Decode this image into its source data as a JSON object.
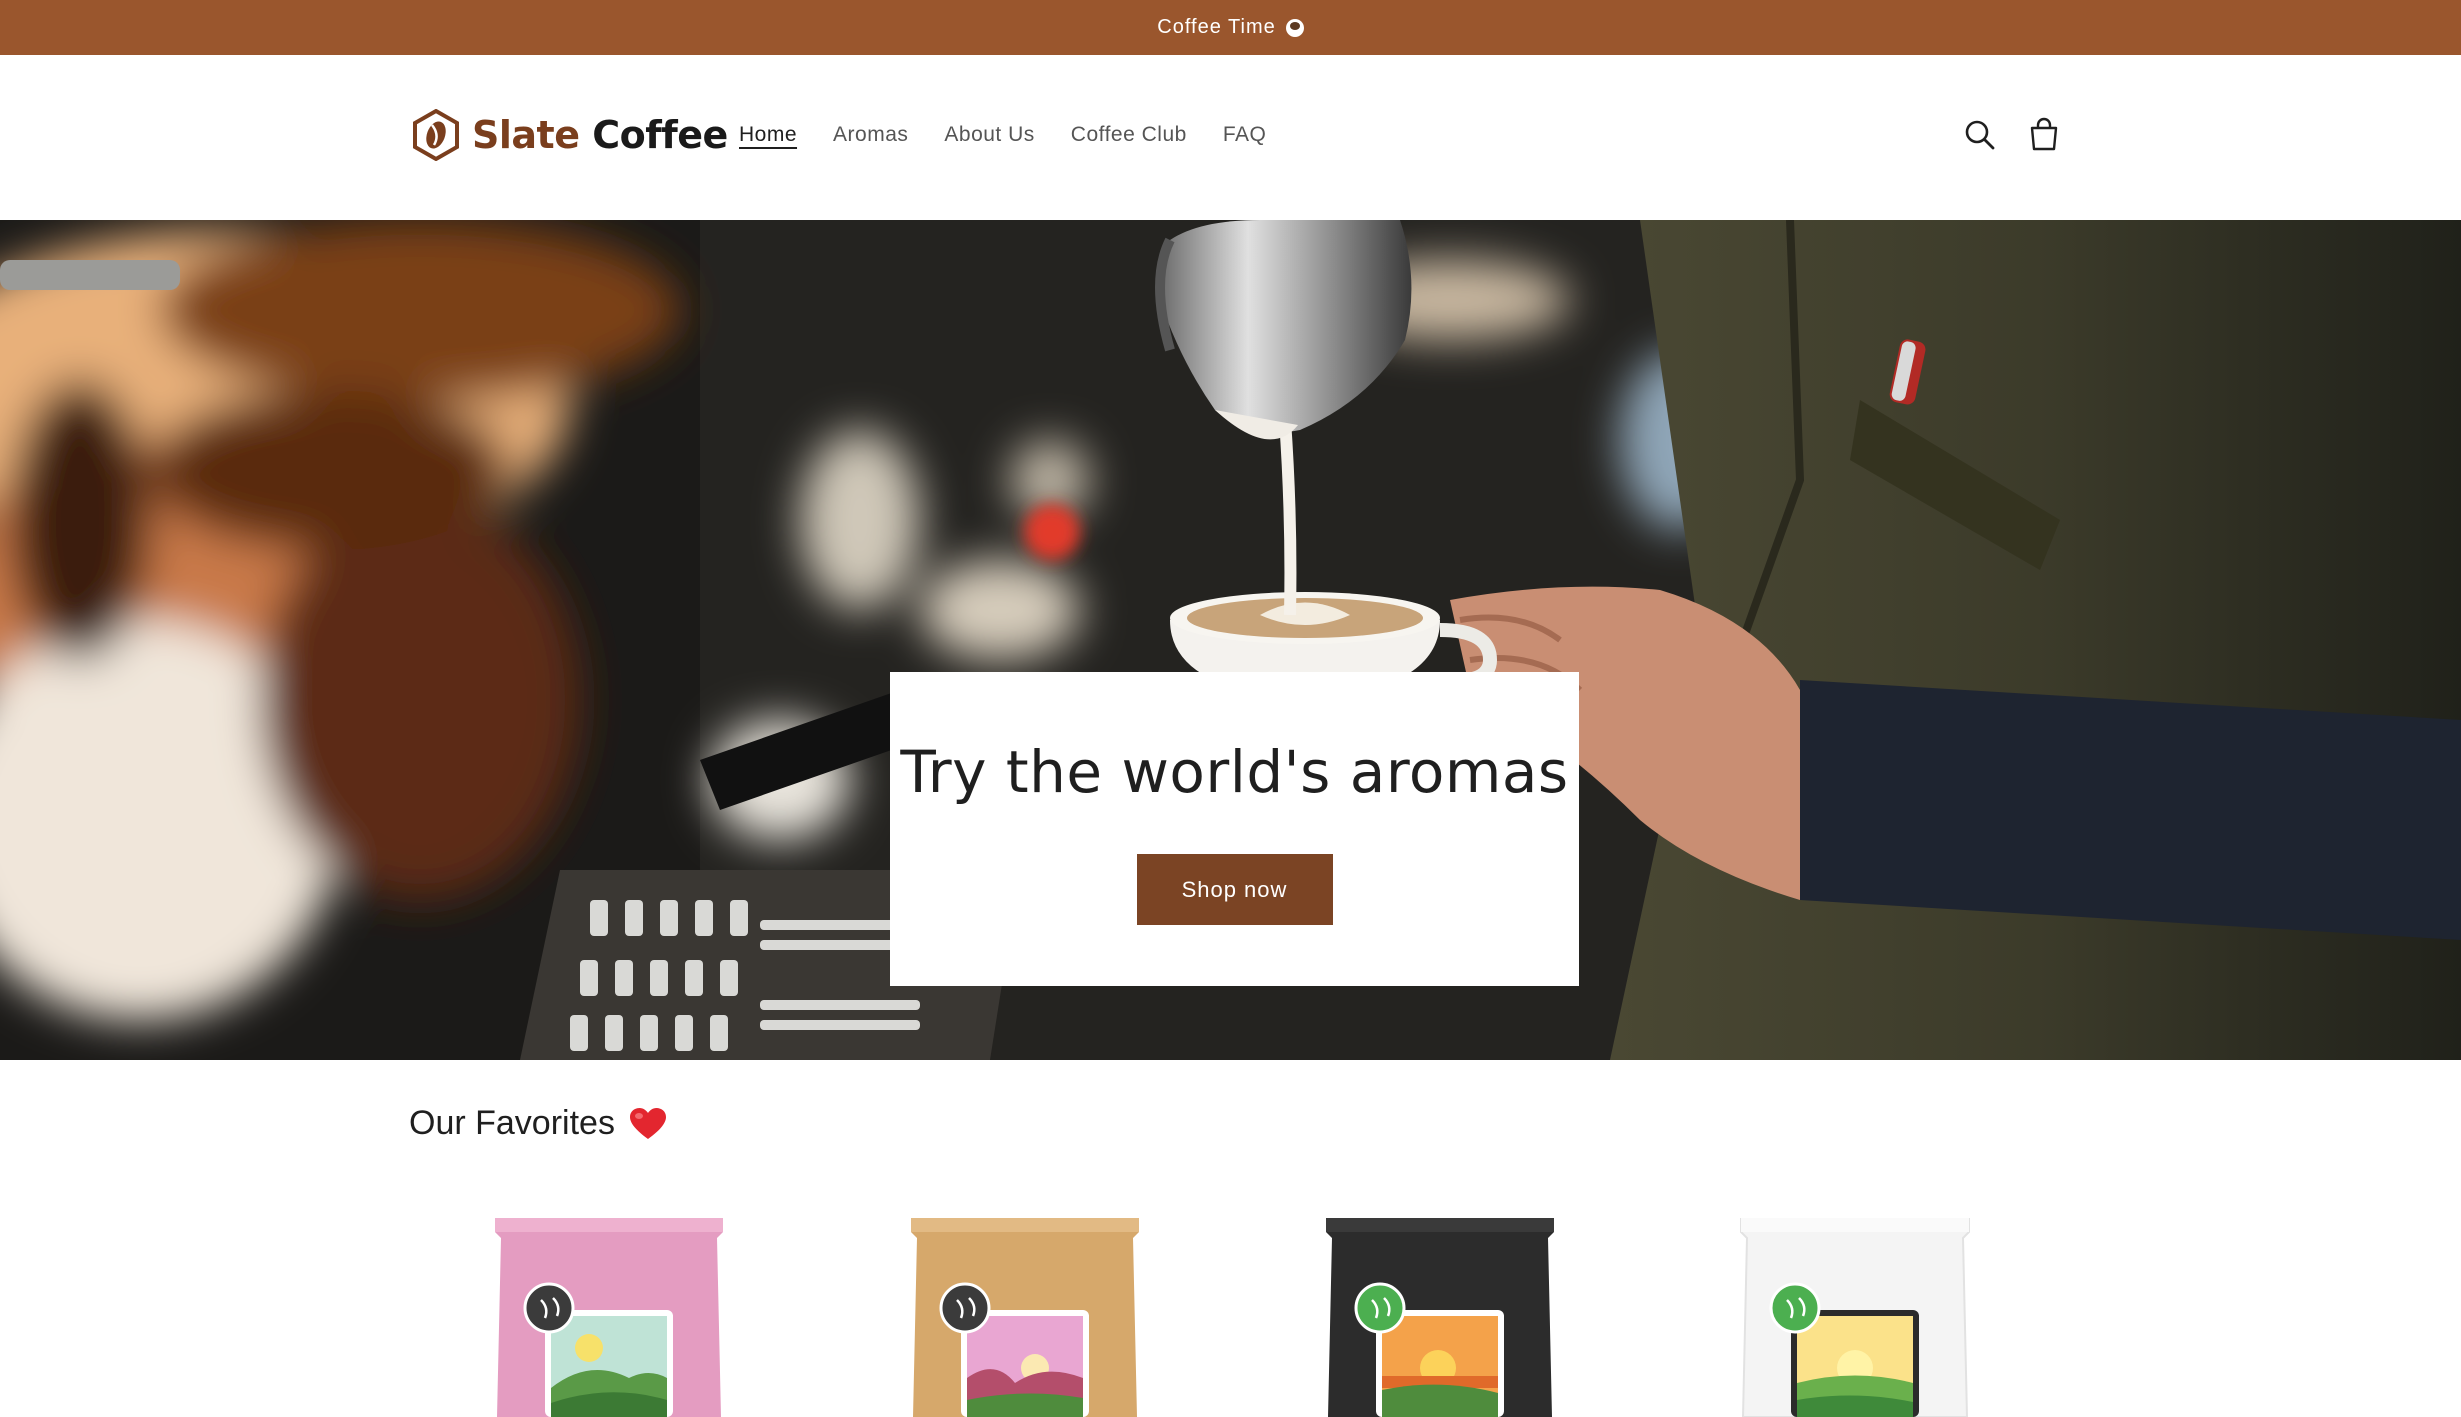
{
  "announcement": {
    "text": "Coffee Time",
    "icon": "coffee-cup-icon"
  },
  "header": {
    "logo": {
      "word1": "Slate",
      "word2": "Coffee",
      "icon": "coffee-bean-hexagon-icon"
    },
    "nav": [
      {
        "label": "Home",
        "active": true
      },
      {
        "label": "Aromas",
        "active": false
      },
      {
        "label": "About Us",
        "active": false
      },
      {
        "label": "Coffee Club",
        "active": false
      },
      {
        "label": "FAQ",
        "active": false
      }
    ],
    "icons": [
      "search-icon",
      "cart-icon"
    ]
  },
  "hero": {
    "heading": "Try the world's aromas",
    "button_label": "Shop now",
    "image": "barista-pouring-latte-art"
  },
  "favorites": {
    "heading": "Our Favorites",
    "icon": "heart-icon",
    "products": [
      {
        "bag_color": "#e49cc1",
        "label_scene": "green hills with yellow sun"
      },
      {
        "bag_color": "#d6a86b",
        "label_scene": "pink sunset over hills"
      },
      {
        "bag_color": "#2c2c2c",
        "label_scene": "orange sunset over hills"
      },
      {
        "bag_color": "#f4f4f4",
        "label_scene": "yellow sunrise over green field"
      }
    ]
  },
  "colors": {
    "brand": "#9a562d",
    "button": "#7b4424",
    "logo_accent": "#7a3e1d"
  }
}
